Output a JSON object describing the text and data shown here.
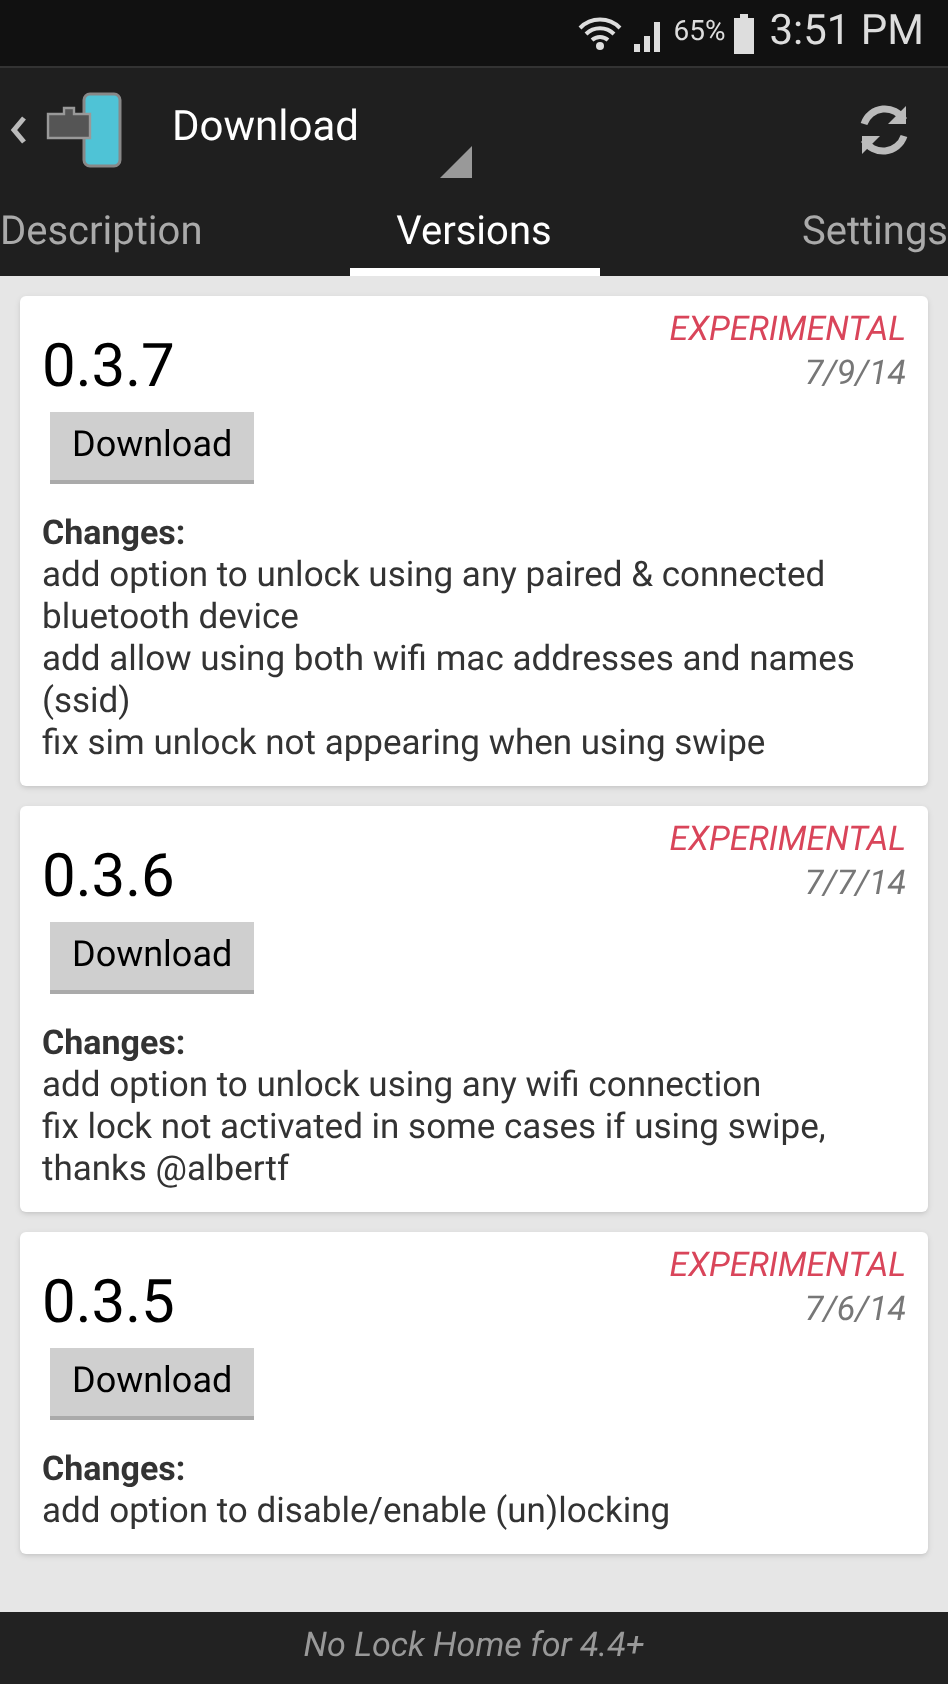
{
  "status_bar": {
    "battery": "65%",
    "time": "3:51 PM"
  },
  "action_bar": {
    "title": "Download"
  },
  "tabs": [
    {
      "label": "Description",
      "selected": false
    },
    {
      "label": "Versions",
      "selected": true
    },
    {
      "label": "Settings",
      "selected": false
    }
  ],
  "versions": [
    {
      "version": "0.3.7",
      "channel": "EXPERIMENTAL",
      "date": "7/9/14",
      "button": "Download",
      "changes_label": "Changes:",
      "changes": [
        "add option to unlock using any paired & connected bluetooth device",
        "add allow using both wifi mac addresses and names (ssid)",
        "fix sim unlock not appearing when using swipe"
      ]
    },
    {
      "version": "0.3.6",
      "channel": "EXPERIMENTAL",
      "date": "7/7/14",
      "button": "Download",
      "changes_label": "Changes:",
      "changes": [
        "add option to unlock using any wifi connection",
        "fix lock not activated in some cases if using swipe, thanks @albertf"
      ]
    },
    {
      "version": "0.3.5",
      "channel": "EXPERIMENTAL",
      "date": "7/6/14",
      "button": "Download",
      "changes_label": "Changes:",
      "changes": [
        "add option to disable/enable (un)locking"
      ]
    }
  ],
  "footer": "No Lock Home for 4.4+"
}
